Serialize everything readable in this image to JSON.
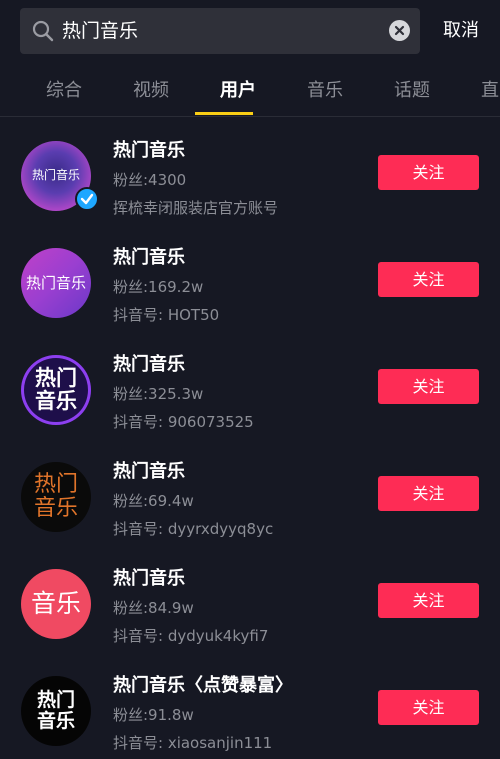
{
  "search": {
    "query": "热门音乐",
    "cancel_label": "取消"
  },
  "tabs": [
    {
      "label": "综合",
      "active": false
    },
    {
      "label": "视频",
      "active": false
    },
    {
      "label": "用户",
      "active": true
    },
    {
      "label": "音乐",
      "active": false
    },
    {
      "label": "话题",
      "active": false
    },
    {
      "label": "直",
      "active": false
    }
  ],
  "users": [
    {
      "name": "热门音乐",
      "fans": "粉丝:4300",
      "sub": "挥梳幸闭服装店官方账号",
      "avatar_text": "热门音乐",
      "verified": true,
      "follow_label": "关注"
    },
    {
      "name": "热门音乐",
      "fans": "粉丝:169.2w",
      "sub": "抖音号: HOT50",
      "avatar_text": "热门音乐",
      "verified": false,
      "follow_label": "关注"
    },
    {
      "name": "热门音乐",
      "fans": "粉丝:325.3w",
      "sub": "抖音号: 906073525",
      "avatar_text": "热门 音乐",
      "verified": false,
      "follow_label": "关注"
    },
    {
      "name": "热门音乐",
      "fans": "粉丝:69.4w",
      "sub": "抖音号: dyyrxdyyq8yc",
      "avatar_text": "热门 音乐",
      "verified": false,
      "follow_label": "关注"
    },
    {
      "name": "热门音乐",
      "fans": "粉丝:84.9w",
      "sub": "抖音号: dydyuk4kyfi7",
      "avatar_text": "音乐",
      "verified": false,
      "follow_label": "关注"
    },
    {
      "name": "热门音乐〈点赞暴富〉",
      "fans": "粉丝:91.8w",
      "sub": "抖音号: xiaosanjin111",
      "avatar_text": "热门 音乐",
      "verified": false,
      "follow_label": "关注"
    }
  ],
  "colors": {
    "background": "#161823",
    "accent_red": "#fe2c55",
    "tab_indicator": "#face15",
    "verified_blue": "#1ea7ff"
  }
}
